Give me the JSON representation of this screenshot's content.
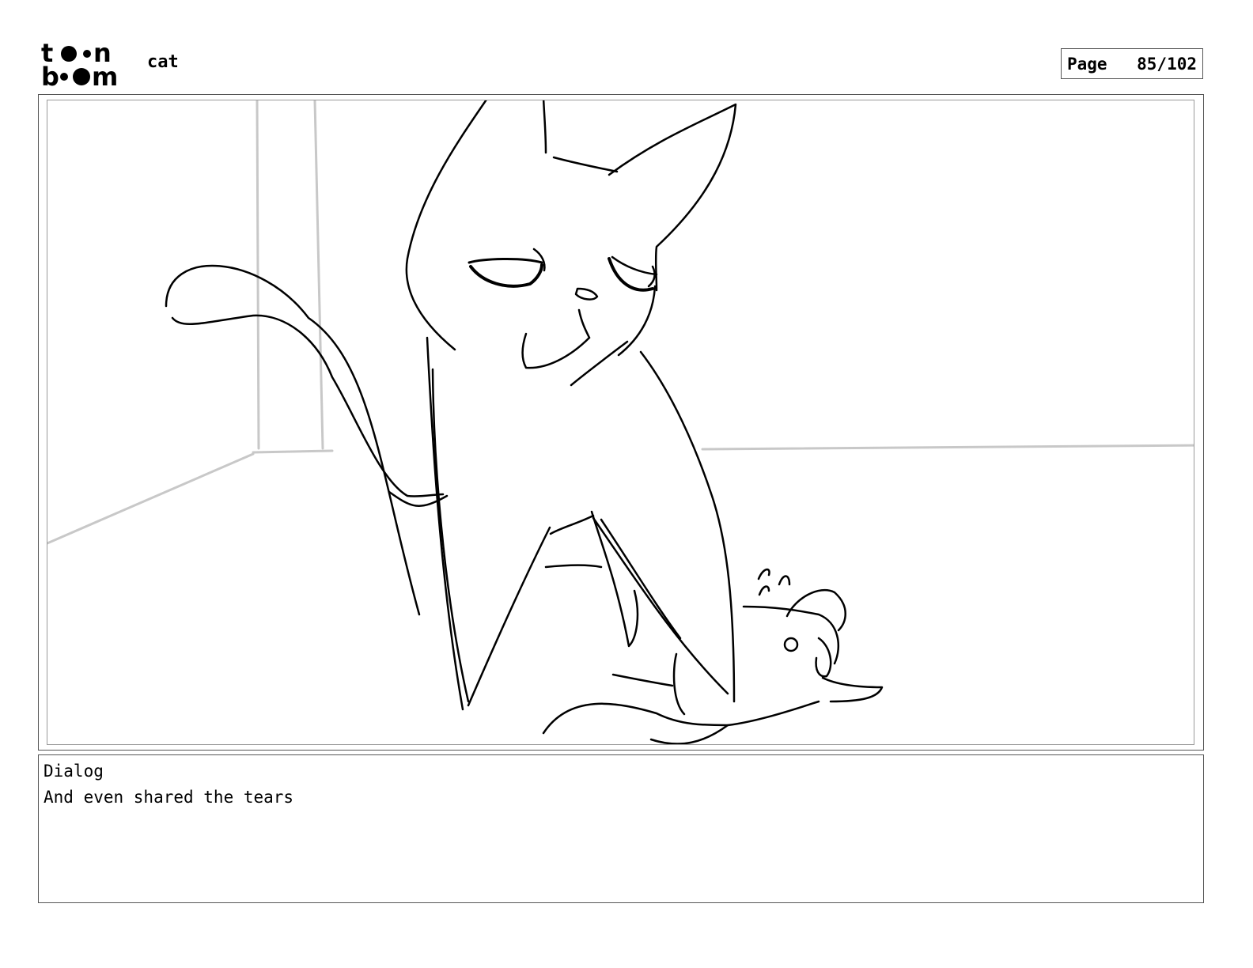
{
  "header": {
    "logo_text": "toon boom",
    "project_title": "cat",
    "page_label": "Page",
    "page_number": "85/102"
  },
  "panel": {
    "icon": "storyboard-panel"
  },
  "dialog": {
    "label": "Dialog",
    "text": "And even shared the tears"
  }
}
